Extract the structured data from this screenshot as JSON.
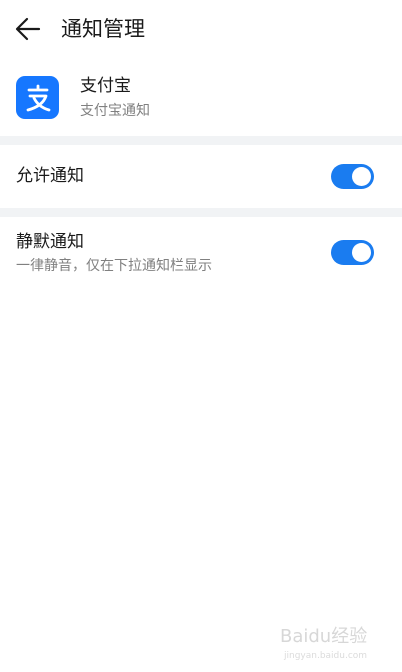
{
  "header": {
    "title": "通知管理",
    "back_icon": "arrow-left-icon"
  },
  "app": {
    "name": "支付宝",
    "subtitle": "支付宝通知",
    "icon": "alipay-logo-icon",
    "icon_color": "#1677ff"
  },
  "settings": [
    {
      "label": "允许通知",
      "enabled": true
    },
    {
      "label": "静默通知",
      "description": "一律静音，仅在下拉通知栏显示",
      "enabled": true
    }
  ],
  "colors": {
    "accent": "#1a7cf0",
    "divider": "#f1f3f5",
    "secondary_text": "#808080"
  },
  "watermark": {
    "text": "Baidu经验",
    "url_text": "jingyan.baidu.com"
  }
}
